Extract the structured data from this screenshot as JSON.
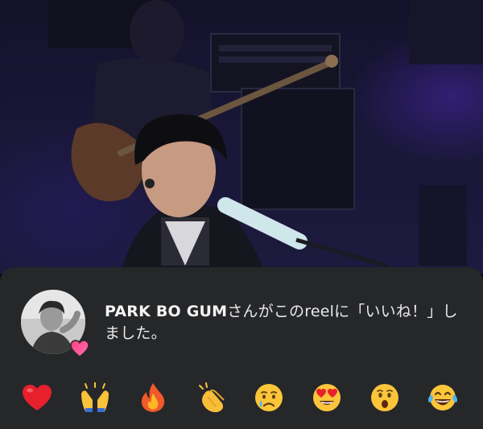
{
  "notification": {
    "username": "PARK BO GUM",
    "message_text": "さんがこのreelに「いいね！」しました。"
  },
  "icons": {
    "avatar": "profile-photo",
    "badge": "gradient-heart-icon"
  },
  "reactions": [
    {
      "name": "red-heart",
      "glyph": "❤️"
    },
    {
      "name": "raising-hands",
      "glyph": "🙌"
    },
    {
      "name": "fire",
      "glyph": "🔥"
    },
    {
      "name": "clapping-hands",
      "glyph": "👏"
    },
    {
      "name": "crying-face",
      "glyph": "😢"
    },
    {
      "name": "heart-eyes",
      "glyph": "😍"
    },
    {
      "name": "surprised-face",
      "glyph": "😮"
    },
    {
      "name": "tears-of-joy",
      "glyph": "😂"
    }
  ],
  "colors": {
    "sheet_background": "#262729",
    "text": "#e9e9ea",
    "badge_gradient_start": "#ff3f7f",
    "badge_gradient_end": "#ff6fb0"
  }
}
